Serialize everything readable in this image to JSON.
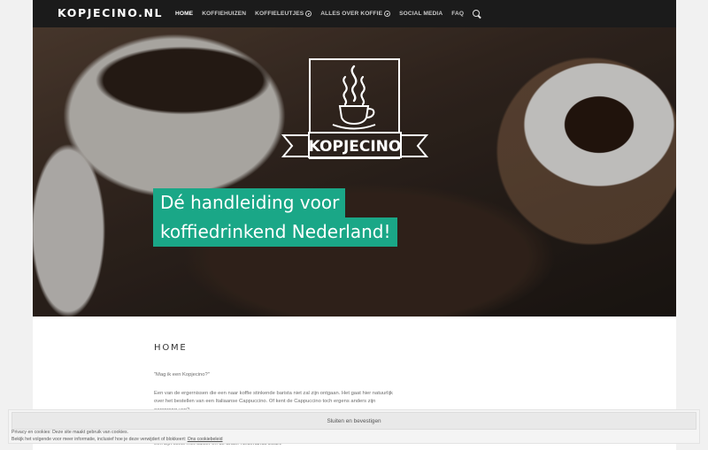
{
  "site": {
    "logo": "KOPJECINO.NL"
  },
  "nav": {
    "items": [
      {
        "label": "HOME",
        "has_sub": false
      },
      {
        "label": "KOFFIEHUIZEN",
        "has_sub": false
      },
      {
        "label": "KOFFIELEUTJES",
        "has_sub": true
      },
      {
        "label": "ALLES OVER KOFFIE",
        "has_sub": true
      },
      {
        "label": "SOCIAL MEDIA",
        "has_sub": false
      },
      {
        "label": "FAQ",
        "has_sub": false
      }
    ]
  },
  "hero": {
    "emblem_text": "KOPJECINO",
    "tagline_line1": "Dé handleiding voor",
    "tagline_line2": "koffiedrinkend Nederland!",
    "accent": "#1aa787"
  },
  "page": {
    "title": "HOME",
    "quote": "\"Mag ik een Kopjecino?\"",
    "paragraph": "Een van de ergernissen die een naar koffie stinkende barista niet zal zijn ontgaan. Het gaat hier natuurlijk over het bestellen van een Italiaanse Cappuccino. Of kent de Cappuccino toch ergens anders zijn oorsprong van?",
    "paragraph_tail": "een zijn koffie met suiker en de ander Nederlands zwart."
  },
  "cookie": {
    "button": "Sluiten en bevestigen",
    "line1": "Privacy en cookies: Deze site maakt gebruik van cookies.",
    "line2": "Bekijk het volgende voor meer informatie, inclusief hoe je deze verwijdert of blokkeert:",
    "link": "Ons cookiebeleid"
  }
}
